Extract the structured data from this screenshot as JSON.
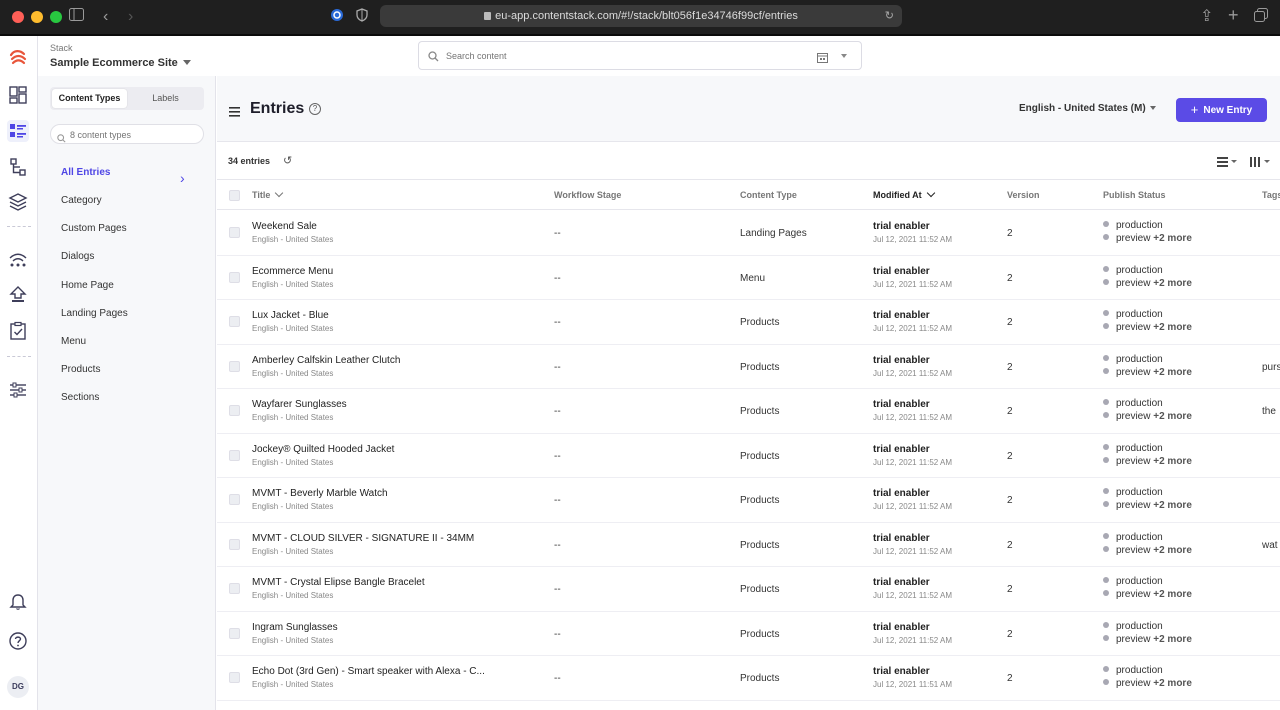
{
  "browser": {
    "url": "eu-app.contentstack.com/#!/stack/blt056f1e34746f99cf/entries"
  },
  "stack": {
    "label": "Stack",
    "name": "Sample Ecommerce Site"
  },
  "search": {
    "placeholder": "Search content"
  },
  "panel": {
    "tab_content_types": "Content Types",
    "tab_labels": "Labels",
    "search_placeholder": "8 content types",
    "items": [
      "All Entries",
      "Category",
      "Custom Pages",
      "Dialogs",
      "Home Page",
      "Landing Pages",
      "Menu",
      "Products",
      "Sections"
    ]
  },
  "header": {
    "title": "Entries",
    "locale": "English - United States (M)",
    "new_entry": "New Entry"
  },
  "list": {
    "count": "34 entries",
    "columns": [
      "Title",
      "Workflow Stage",
      "Content Type",
      "Modified At",
      "Version",
      "Publish Status",
      "Tags"
    ],
    "rows": [
      {
        "title": "Weekend Sale",
        "locale": "English - United States",
        "workflow": "--",
        "content_type": "Landing Pages",
        "modified_by": "trial enabler",
        "modified_at": "Jul 12, 2021 11:52 AM",
        "version": "2",
        "pub1": "production",
        "pub2": "preview",
        "more": "+2 more",
        "tags": ""
      },
      {
        "title": "Ecommerce Menu",
        "locale": "English - United States",
        "workflow": "--",
        "content_type": "Menu",
        "modified_by": "trial enabler",
        "modified_at": "Jul 12, 2021 11:52 AM",
        "version": "2",
        "pub1": "production",
        "pub2": "preview",
        "more": "+2 more",
        "tags": ""
      },
      {
        "title": "Lux Jacket - Blue",
        "locale": "English - United States",
        "workflow": "--",
        "content_type": "Products",
        "modified_by": "trial enabler",
        "modified_at": "Jul 12, 2021 11:52 AM",
        "version": "2",
        "pub1": "production",
        "pub2": "preview",
        "more": "+2 more",
        "tags": ""
      },
      {
        "title": "Amberley Calfskin Leather Clutch",
        "locale": "English - United States",
        "workflow": "--",
        "content_type": "Products",
        "modified_by": "trial enabler",
        "modified_at": "Jul 12, 2021 11:52 AM",
        "version": "2",
        "pub1": "production",
        "pub2": "preview",
        "more": "+2 more",
        "tags": "purs"
      },
      {
        "title": "Wayfarer Sunglasses",
        "locale": "English - United States",
        "workflow": "--",
        "content_type": "Products",
        "modified_by": "trial enabler",
        "modified_at": "Jul 12, 2021 11:52 AM",
        "version": "2",
        "pub1": "production",
        "pub2": "preview",
        "more": "+2 more",
        "tags": "the"
      },
      {
        "title": "Jockey® Quilted Hooded Jacket",
        "locale": "English - United States",
        "workflow": "--",
        "content_type": "Products",
        "modified_by": "trial enabler",
        "modified_at": "Jul 12, 2021 11:52 AM",
        "version": "2",
        "pub1": "production",
        "pub2": "preview",
        "more": "+2 more",
        "tags": ""
      },
      {
        "title": "MVMT - Beverly Marble Watch",
        "locale": "English - United States",
        "workflow": "--",
        "content_type": "Products",
        "modified_by": "trial enabler",
        "modified_at": "Jul 12, 2021 11:52 AM",
        "version": "2",
        "pub1": "production",
        "pub2": "preview",
        "more": "+2 more",
        "tags": ""
      },
      {
        "title": "MVMT - CLOUD SILVER - SIGNATURE II - 34MM",
        "locale": "English - United States",
        "workflow": "--",
        "content_type": "Products",
        "modified_by": "trial enabler",
        "modified_at": "Jul 12, 2021 11:52 AM",
        "version": "2",
        "pub1": "production",
        "pub2": "preview",
        "more": "+2 more",
        "tags": "wat"
      },
      {
        "title": "MVMT - Crystal Elipse Bangle Bracelet",
        "locale": "English - United States",
        "workflow": "--",
        "content_type": "Products",
        "modified_by": "trial enabler",
        "modified_at": "Jul 12, 2021 11:52 AM",
        "version": "2",
        "pub1": "production",
        "pub2": "preview",
        "more": "+2 more",
        "tags": ""
      },
      {
        "title": "Ingram Sunglasses",
        "locale": "English - United States",
        "workflow": "--",
        "content_type": "Products",
        "modified_by": "trial enabler",
        "modified_at": "Jul 12, 2021 11:52 AM",
        "version": "2",
        "pub1": "production",
        "pub2": "preview",
        "more": "+2 more",
        "tags": ""
      },
      {
        "title": "Echo Dot (3rd Gen) - Smart speaker with Alexa - C...",
        "locale": "English - United States",
        "workflow": "--",
        "content_type": "Products",
        "modified_by": "trial enabler",
        "modified_at": "Jul 12, 2021 11:51 AM",
        "version": "2",
        "pub1": "production",
        "pub2": "preview",
        "more": "+2 more",
        "tags": ""
      }
    ]
  },
  "user": {
    "initials": "DG"
  },
  "colors": {
    "accent": "#5b4be6",
    "link": "#4f46e5"
  }
}
